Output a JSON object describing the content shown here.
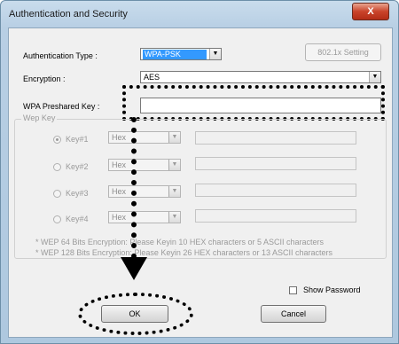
{
  "window": {
    "title": "Authentication and Security",
    "close_glyph": "X"
  },
  "auth": {
    "label": "Authentication Type :",
    "value": "WPA-PSK",
    "button_8021x": "802.1x Setting"
  },
  "encryption": {
    "label": "Encryption :",
    "value": "AES"
  },
  "psk": {
    "label": "WPA Preshared Key :",
    "value": ""
  },
  "wep": {
    "legend": "Wep Key",
    "keys": [
      {
        "label": "Key#1",
        "format": "Hex",
        "value": "",
        "selected": true
      },
      {
        "label": "Key#2",
        "format": "Hex",
        "value": "",
        "selected": false
      },
      {
        "label": "Key#3",
        "format": "Hex",
        "value": "",
        "selected": false
      },
      {
        "label": "Key#4",
        "format": "Hex",
        "value": "",
        "selected": false
      }
    ],
    "note1": "* WEP 64 Bits Encryption:   Please Keyin 10 HEX characters or 5 ASCII characters",
    "note2": "* WEP 128 Bits Encryption:   Please Keyin 26 HEX characters or 13 ASCII characters"
  },
  "show_password": {
    "label": "Show Password",
    "checked": false
  },
  "buttons": {
    "ok": "OK",
    "cancel": "Cancel"
  },
  "icons": {
    "dropdown": "chevron-down-icon"
  }
}
